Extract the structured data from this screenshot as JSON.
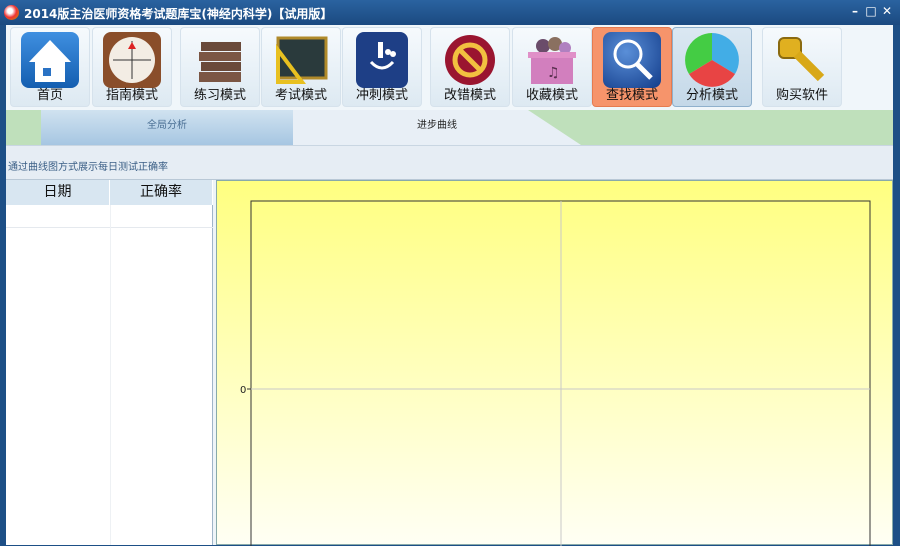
{
  "window": {
    "title": "2014版主治医师资格考试题库宝(神经内科学)【试用版】",
    "minimize": "–",
    "maximize": "□",
    "close": "✕"
  },
  "toolbar": [
    {
      "label": "首页",
      "icon": "home-icon"
    },
    {
      "label": "指南模式",
      "icon": "compass-icon"
    },
    {
      "label": "练习模式",
      "icon": "books-icon"
    },
    {
      "label": "考试模式",
      "icon": "blackboard-icon"
    },
    {
      "label": "冲刺模式",
      "icon": "touch-icon"
    },
    {
      "label": "改错模式",
      "icon": "prohibit-icon"
    },
    {
      "label": "收藏模式",
      "icon": "box-icon"
    },
    {
      "label": "查找模式",
      "icon": "magnifier-icon"
    },
    {
      "label": "分析模式",
      "icon": "pie-chart-icon"
    },
    {
      "label": "购买软件",
      "icon": "key-icon"
    }
  ],
  "tabs": [
    "全局分析",
    "进步曲线"
  ],
  "description": "通过曲线图方式展示每日测试正确率",
  "table": {
    "columns": [
      "日期",
      "正确率"
    ],
    "rows": []
  },
  "chart_data": {
    "type": "line",
    "title": "",
    "xlabel": "",
    "ylabel": "",
    "series": [],
    "yticks": [
      "0"
    ],
    "grid": true
  }
}
